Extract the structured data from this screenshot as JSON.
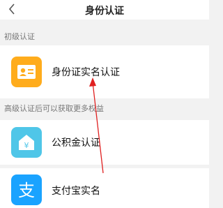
{
  "nav": {
    "title": "身份认证",
    "back_icon": "chevron-left-icon"
  },
  "sections": {
    "basic_label": "初级认证",
    "advanced_label": "高级认证后可以获取更多权益"
  },
  "items": [
    {
      "label": "身份证实名认证",
      "icon": "id-card-icon",
      "icon_color": "#ffac1c"
    },
    {
      "label": "公积金认证",
      "icon": "housing-fund-icon",
      "icon_color": "#4fc6e8"
    },
    {
      "label": "支付宝实名",
      "icon": "alipay-icon",
      "icon_color": "#1aa3ff"
    }
  ],
  "colors": {
    "background": "#f2f2f2",
    "annotation_arrow": "#e02020"
  }
}
